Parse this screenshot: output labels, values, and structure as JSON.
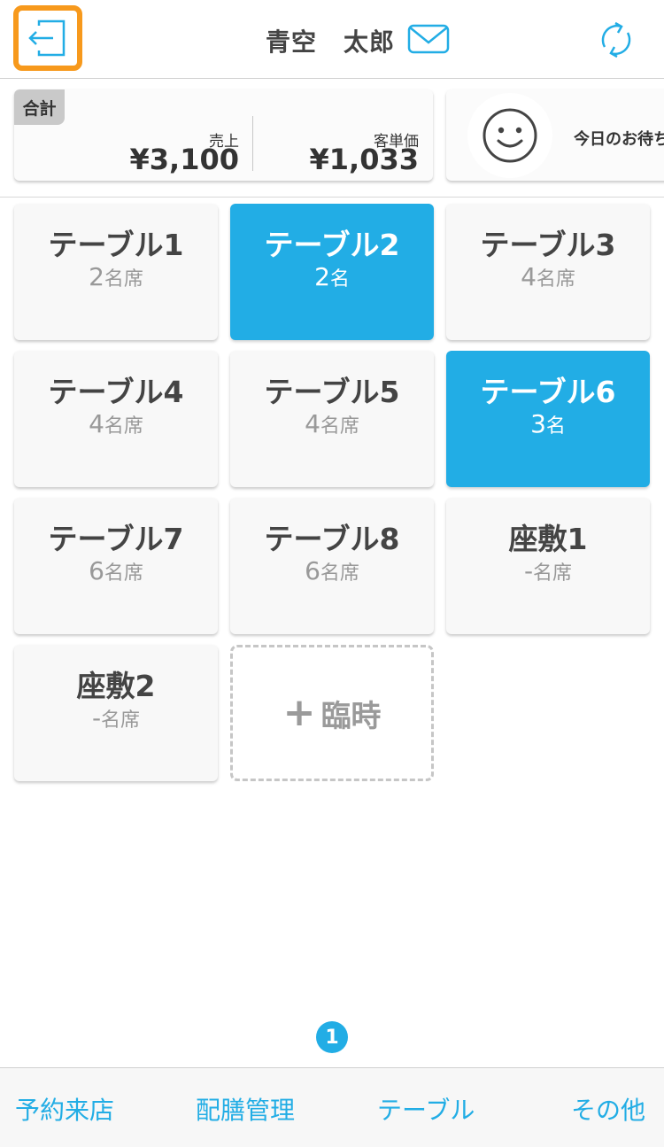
{
  "header": {
    "user_family_name": "青空",
    "user_given_name": "太郎"
  },
  "icons": {
    "logout": "logout-icon",
    "mail": "mail-icon",
    "refresh": "refresh-icon",
    "smiley": "smiley-icon",
    "plus": "plus-icon"
  },
  "colors": {
    "accent": "#22ade5",
    "highlight_border": "#f7991c",
    "card_bg": "#f8f8f8"
  },
  "summary": {
    "badge": "合計",
    "sales_label": "売上",
    "sales_value": "¥3,100",
    "avg_label": "客単価",
    "avg_value": "¥1,033",
    "waiting_label": "今日のお待ち"
  },
  "tables": [
    {
      "name": "テーブル1",
      "count": "2",
      "unit": "名席",
      "occupied": false
    },
    {
      "name": "テーブル2",
      "count": "2",
      "unit": "名",
      "occupied": true
    },
    {
      "name": "テーブル3",
      "count": "4",
      "unit": "名席",
      "occupied": false
    },
    {
      "name": "テーブル4",
      "count": "4",
      "unit": "名席",
      "occupied": false
    },
    {
      "name": "テーブル5",
      "count": "4",
      "unit": "名席",
      "occupied": false
    },
    {
      "name": "テーブル6",
      "count": "3",
      "unit": "名",
      "occupied": true
    },
    {
      "name": "テーブル7",
      "count": "6",
      "unit": "名席",
      "occupied": false
    },
    {
      "name": "テーブル8",
      "count": "6",
      "unit": "名席",
      "occupied": false
    },
    {
      "name": "座敷1",
      "count": "-",
      "unit": "名席",
      "occupied": false
    },
    {
      "name": "座敷2",
      "count": "-",
      "unit": "名席",
      "occupied": false
    }
  ],
  "temp_table": {
    "plus": "+",
    "label": "臨時"
  },
  "pager": {
    "current": "1"
  },
  "tabbar": {
    "items": [
      "予約来店",
      "配膳管理",
      "テーブル",
      "その他"
    ]
  }
}
